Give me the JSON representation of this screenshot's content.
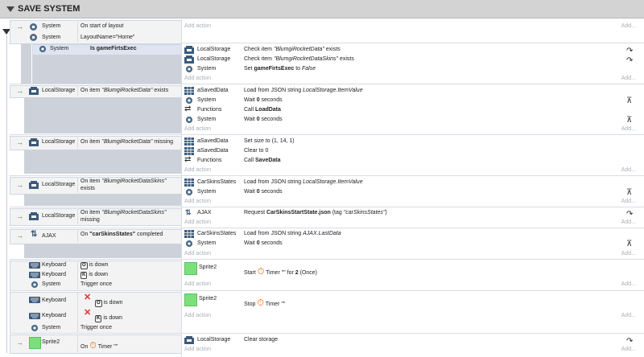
{
  "group": {
    "title": "SAVE SYSTEM"
  },
  "placeholders": {
    "add_action": "Add action",
    "dots": "Add..."
  },
  "events": {
    "e1": {
      "c1_obj": "System",
      "c1_text": "On start of layout",
      "c2_obj": "System",
      "c2_text": "LayoutName=\"Home\""
    },
    "e1sub": {
      "c1_obj": "System",
      "c1_text": "Is gameFirtsExec",
      "a1_obj": "LocalStorage",
      "a1_text": "Check item \"BlumgiRocketData\" exists",
      "a2_obj": "LocalStorage",
      "a2_text": "Check item \"BlumgiRocketDataSkins\" exists",
      "a3_obj": "System",
      "a3_pre": "Set ",
      "a3_var": "gameFirtsExec",
      "a3_mid": " to ",
      "a3_val": "False"
    },
    "e2": {
      "c1_obj": "LocalStorage",
      "c1_pre": "On item ",
      "c1_item": "\"BlumgiRocketData\"",
      "c1_post": " exists",
      "a1_obj": "aSavedData",
      "a1_pre": "Load from JSON string ",
      "a1_val": "LocalStorage.ItemValue",
      "a2_obj": "System",
      "a2_pre": "Wait ",
      "a2_val": "0",
      "a2_post": " seconds",
      "a3_obj": "Functions",
      "a3_pre": "Call ",
      "a3_val": "LoadData",
      "a4_obj": "System",
      "a4_pre": "Wait ",
      "a4_val": "0",
      "a4_post": " seconds"
    },
    "e3": {
      "c1_obj": "LocalStorage",
      "c1_pre": "On item ",
      "c1_item": "\"BlumgiRocketData\"",
      "c1_post": " missing",
      "a1_obj": "aSavedData",
      "a1_text": "Set size to (1, 14, 1)",
      "a2_obj": "aSavedData",
      "a2_text": "Clear to 0",
      "a3_obj": "Functions",
      "a3_pre": "Call ",
      "a3_val": "SaveData"
    },
    "e4": {
      "c1_obj": "LocalStorage",
      "c1_pre": "On item ",
      "c1_item": "\"BlumgiRocketDataSkins\"",
      "c1_post": "exists",
      "a1_obj": "CarSkinsStates",
      "a1_pre": "Load from JSON string ",
      "a1_val": "LocalStorage.ItemValue",
      "a2_obj": "System",
      "a2_pre": "Wait ",
      "a2_val": "0",
      "a2_post": " seconds"
    },
    "e5": {
      "c1_obj": "LocalStorage",
      "c1_pre": "On item ",
      "c1_item": "\"BlumgiRocketDataSkins\"",
      "c1_post": "missing",
      "a1_obj": "AJAX",
      "a1_pre": "Request ",
      "a1_val": "CarSkinsStartState.json",
      "a1_post": " (tag ",
      "a1_tag": "\"carSkinsStates\"",
      "a1_end": ")"
    },
    "e6": {
      "c1_obj": "AJAX",
      "c1_pre": "On ",
      "c1_val": "\"carSkinsStates\"",
      "c1_post": " completed",
      "a1_obj": "CarSkinsStates",
      "a1_pre": "Load from JSON string ",
      "a1_val": "AJAX.LastData",
      "a2_obj": "System",
      "a2_pre": "Wait ",
      "a2_val": "0",
      "a2_post": " seconds"
    },
    "e7": {
      "c1_obj": "Keyboard",
      "c1_key": "O",
      "c1_text": "is down",
      "c2_obj": "Keyboard",
      "c2_key": "K",
      "c2_text": "is down",
      "c3_obj": "System",
      "c3_text": "Trigger once",
      "a1_obj": "Sprite2",
      "a1_pre": "Start ",
      "a1_mid": "Timer \"\" for ",
      "a1_val": "2",
      "a1_post": " (Once)"
    },
    "e8": {
      "c1_obj": "Keyboard",
      "c1_key": "O",
      "c1_text": "is down",
      "c2_obj": "Keyboard",
      "c2_key": "K",
      "c2_text": "is down",
      "c3_obj": "System",
      "c3_text": "Trigger once",
      "a1_obj": "Sprite2",
      "a1_pre": "Stop ",
      "a1_post": "Timer \"\""
    },
    "e9": {
      "c1_obj": "Sprite2",
      "c1_pre": "On ",
      "c1_post": "Timer \"\"",
      "a1_obj": "LocalStorage",
      "a1_text": "Clear storage"
    }
  },
  "colors": {
    "green": "#2a8a2a",
    "red": "#e03030",
    "sprite": "#7be07b"
  }
}
